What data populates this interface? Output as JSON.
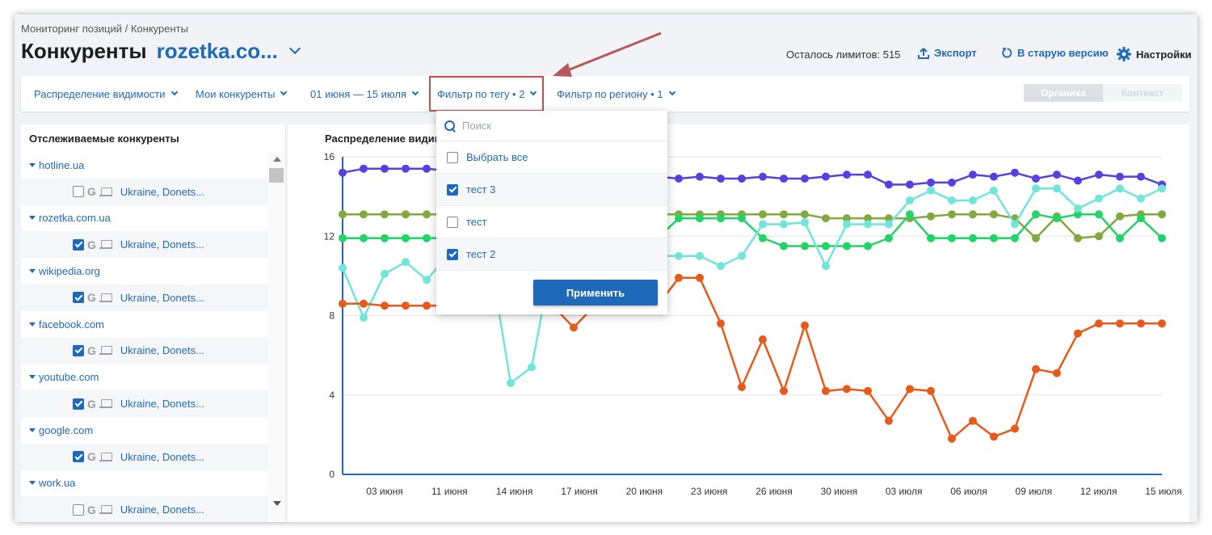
{
  "header": {
    "breadcrumb": "Мониторинг позиций / Конкуренты",
    "title": "Конкуренты",
    "domain": "rozetka.co...",
    "limits": "Осталось лимитов: 515",
    "export_label": "Экспорт",
    "old_version_label": "В старую версию",
    "settings_label": "Настройки"
  },
  "toolbar": {
    "visibility": "Распределение видимости",
    "competitors": "Мои конкуренты",
    "dates": "01 июня — 15 июля",
    "tag_filter": "Фильтр по тегу • 2",
    "region_filter": "Фильтр по региону • 1",
    "organic": "Органика",
    "context": "Контекст"
  },
  "left_panel": {
    "heading": "Отслеживаемые конкуренты",
    "items": [
      {
        "domain": "hotline.ua",
        "checked": false,
        "region": "Ukraine, Donets..."
      },
      {
        "domain": "rozetka.com.ua",
        "checked": true,
        "region": "Ukraine, Donets..."
      },
      {
        "domain": "wikipedia.org",
        "checked": true,
        "region": "Ukraine, Donets..."
      },
      {
        "domain": "facebook.com",
        "checked": true,
        "region": "Ukraine, Donets..."
      },
      {
        "domain": "youtube.com",
        "checked": true,
        "region": "Ukraine, Donets..."
      },
      {
        "domain": "google.com",
        "checked": true,
        "region": "Ukraine, Donets..."
      },
      {
        "domain": "work.ua",
        "checked": false,
        "region": "Ukraine, Donets..."
      }
    ]
  },
  "dropdown": {
    "search_placeholder": "Поиск",
    "options": [
      {
        "label": "Выбрать все",
        "checked": false
      },
      {
        "label": "тест 3",
        "checked": true
      },
      {
        "label": "тест",
        "checked": false
      },
      {
        "label": "тест 2",
        "checked": true
      }
    ],
    "apply_label": "Применить"
  },
  "chart_title": "Распределение видимо",
  "chart_data": {
    "type": "line",
    "title": "Распределение видимо",
    "x_ticks": [
      "03 июня",
      "11 июня",
      "14 июня",
      "17 июня",
      "20 июня",
      "23 июня",
      "26 июня",
      "30 июня",
      "03 июля",
      "06 июля",
      "09 июля",
      "12 июля",
      "15 июля"
    ],
    "y_ticks": [
      0,
      4,
      8,
      12,
      16
    ],
    "ylim": [
      0,
      16
    ],
    "n_points": 40,
    "series": [
      {
        "color": "#5a3fe0",
        "values": [
          15.2,
          15.4,
          15.4,
          15.4,
          15.4,
          15.3,
          15.2,
          15.1,
          15.1,
          15.0,
          15.0,
          15.0,
          15.0,
          15.0,
          15.0,
          15.0,
          14.9,
          15.0,
          14.9,
          14.9,
          15.0,
          14.9,
          14.9,
          15.0,
          15.1,
          15.1,
          14.6,
          14.6,
          14.7,
          14.7,
          15.1,
          15.0,
          15.2,
          14.9,
          15.1,
          14.8,
          15.1,
          15.0,
          15.0,
          14.6
        ]
      },
      {
        "color": "#82a93d",
        "values": [
          13.1,
          13.1,
          13.1,
          13.1,
          13.1,
          13.1,
          13.1,
          13.1,
          13.1,
          13.1,
          13.1,
          13.1,
          13.1,
          13.1,
          13.1,
          13.1,
          13.1,
          13.1,
          13.1,
          13.1,
          13.1,
          13.1,
          13.1,
          12.9,
          12.9,
          12.9,
          12.9,
          12.9,
          13.0,
          13.1,
          13.1,
          13.1,
          12.9,
          11.9,
          13.0,
          11.9,
          12.0,
          13.0,
          13.1,
          13.1
        ]
      },
      {
        "color": "#22d36a",
        "values": [
          11.9,
          11.9,
          11.9,
          11.9,
          11.9,
          11.9,
          11.9,
          11.9,
          11.9,
          11.9,
          11.9,
          11.9,
          11.9,
          11.9,
          11.9,
          11.9,
          12.9,
          12.9,
          12.9,
          12.9,
          11.9,
          11.5,
          11.5,
          11.5,
          11.5,
          11.5,
          11.9,
          13.1,
          11.9,
          11.9,
          11.9,
          11.9,
          11.9,
          13.1,
          12.9,
          13.1,
          13.1,
          11.9,
          12.9,
          11.9
        ]
      },
      {
        "color": "#6fe6d8",
        "values": [
          10.4,
          7.9,
          10.1,
          10.7,
          9.8,
          11.0,
          11.0,
          11.0,
          4.6,
          5.4,
          11.0,
          11.0,
          11.0,
          11.0,
          11.0,
          11.0,
          11.0,
          11.0,
          10.5,
          11.0,
          12.6,
          12.6,
          12.7,
          10.5,
          12.6,
          12.6,
          12.6,
          13.8,
          14.3,
          13.8,
          13.8,
          14.3,
          12.6,
          14.4,
          14.4,
          13.4,
          13.9,
          14.4,
          13.9,
          14.4
        ]
      },
      {
        "color": "#e85a1b",
        "values": [
          8.6,
          8.6,
          8.5,
          8.5,
          8.5,
          8.5,
          8.5,
          8.5,
          8.5,
          8.5,
          8.5,
          7.4,
          8.5,
          8.5,
          8.5,
          8.5,
          9.9,
          9.9,
          7.6,
          4.4,
          6.8,
          4.2,
          7.5,
          4.2,
          4.3,
          4.2,
          2.7,
          4.3,
          4.2,
          1.8,
          2.7,
          1.9,
          2.3,
          5.3,
          5.1,
          7.1,
          7.6,
          7.6,
          7.6,
          7.6
        ]
      }
    ]
  }
}
